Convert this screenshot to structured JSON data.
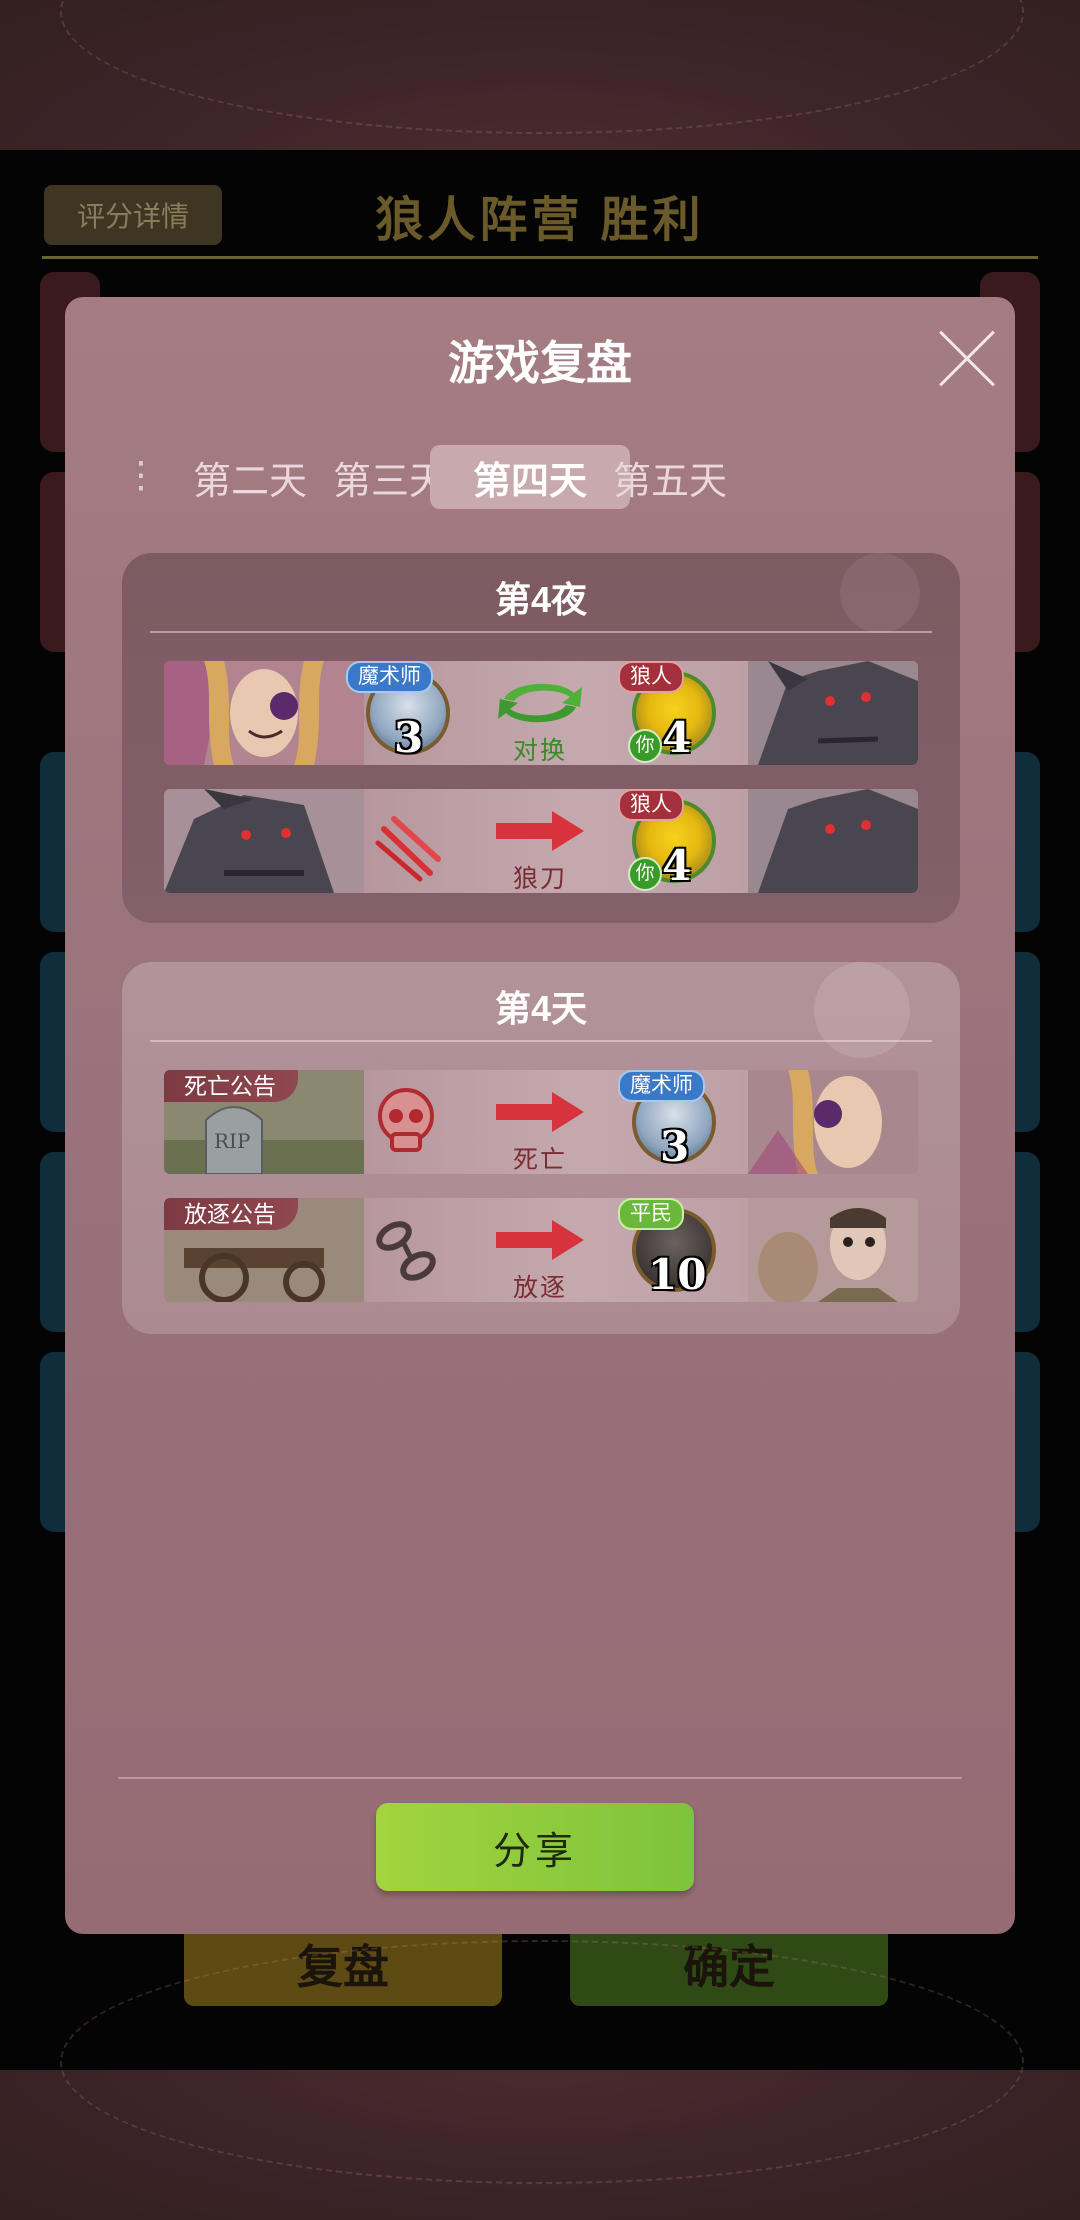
{
  "background": {
    "score_button": "评分详情",
    "result_title": "狼人阵营  胜利",
    "buttons": {
      "replay": "复盘",
      "confirm": "确定"
    }
  },
  "modal": {
    "title": "游戏复盘",
    "tabs": [
      "第二天",
      "第三天",
      "第四天",
      "第五天"
    ],
    "active_tab": "第四天",
    "share_label": "分享",
    "sections": {
      "night": {
        "title": "第4夜",
        "rows": [
          {
            "actor_role": "魔术师",
            "actor_seat": "3",
            "action": "对换",
            "target_role": "狼人",
            "target_seat": "4",
            "target_you": "你"
          },
          {
            "action": "狼刀",
            "target_role": "狼人",
            "target_seat": "4",
            "target_you": "你"
          }
        ]
      },
      "day": {
        "title": "第4天",
        "rows": [
          {
            "tag": "死亡公告",
            "action": "死亡",
            "target_role": "魔术师",
            "target_seat": "3"
          },
          {
            "tag": "放逐公告",
            "action": "放逐",
            "target_role": "平民",
            "target_seat": "10"
          }
        ]
      }
    }
  },
  "colors": {
    "accent_green": "#8fcb3c",
    "action_red": "#d8323c",
    "modal_bg": "#a47c82"
  }
}
